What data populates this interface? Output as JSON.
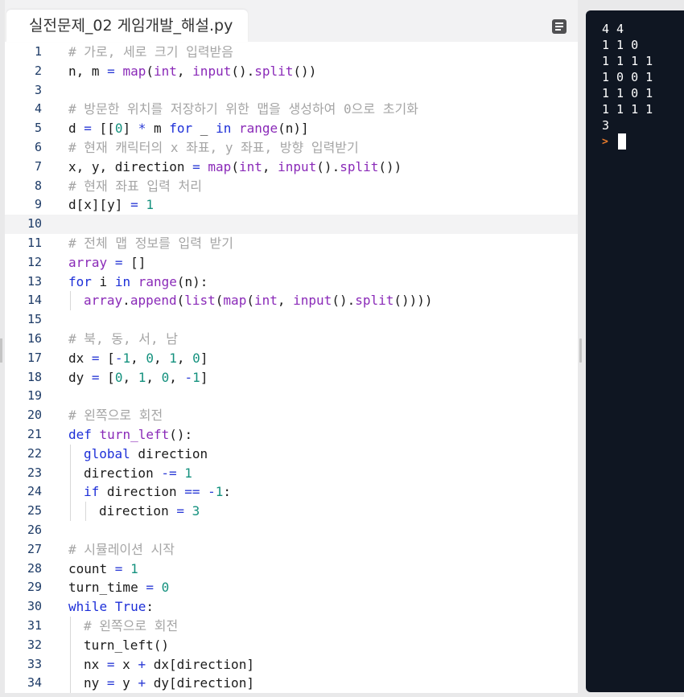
{
  "editor": {
    "tab_title": "실전문제_02 게임개발_해설.py",
    "current_line": 10,
    "lines": [
      {
        "n": "1",
        "indent": 0,
        "tokens": [
          {
            "t": "comment",
            "v": "# 가로, 세로 크기 입력받음"
          }
        ]
      },
      {
        "n": "2",
        "indent": 0,
        "tokens": [
          {
            "t": "plain",
            "v": "n, m "
          },
          {
            "t": "op",
            "v": "="
          },
          {
            "t": "plain",
            "v": " "
          },
          {
            "t": "builtin",
            "v": "map"
          },
          {
            "t": "plain",
            "v": "("
          },
          {
            "t": "builtin",
            "v": "int"
          },
          {
            "t": "plain",
            "v": ", "
          },
          {
            "t": "builtin",
            "v": "input"
          },
          {
            "t": "plain",
            "v": "()."
          },
          {
            "t": "builtin",
            "v": "split"
          },
          {
            "t": "plain",
            "v": "())"
          }
        ]
      },
      {
        "n": "3",
        "indent": 0,
        "tokens": []
      },
      {
        "n": "4",
        "indent": 0,
        "tokens": [
          {
            "t": "comment",
            "v": "# 방문한 위치를 저장하기 위한 맵을 생성하여 0으로 초기화"
          }
        ]
      },
      {
        "n": "5",
        "indent": 0,
        "tokens": [
          {
            "t": "plain",
            "v": "d "
          },
          {
            "t": "op",
            "v": "="
          },
          {
            "t": "plain",
            "v": " [["
          },
          {
            "t": "num",
            "v": "0"
          },
          {
            "t": "plain",
            "v": "] "
          },
          {
            "t": "op",
            "v": "*"
          },
          {
            "t": "plain",
            "v": " m "
          },
          {
            "t": "kw",
            "v": "for"
          },
          {
            "t": "plain",
            "v": " _ "
          },
          {
            "t": "kw",
            "v": "in"
          },
          {
            "t": "plain",
            "v": " "
          },
          {
            "t": "builtin",
            "v": "range"
          },
          {
            "t": "plain",
            "v": "(n)]"
          }
        ]
      },
      {
        "n": "6",
        "indent": 0,
        "tokens": [
          {
            "t": "comment",
            "v": "# 현재 캐릭터의 x 좌표, y 좌표, 방향 입력받기"
          }
        ]
      },
      {
        "n": "7",
        "indent": 0,
        "tokens": [
          {
            "t": "plain",
            "v": "x, y, direction "
          },
          {
            "t": "op",
            "v": "="
          },
          {
            "t": "plain",
            "v": " "
          },
          {
            "t": "builtin",
            "v": "map"
          },
          {
            "t": "plain",
            "v": "("
          },
          {
            "t": "builtin",
            "v": "int"
          },
          {
            "t": "plain",
            "v": ", "
          },
          {
            "t": "builtin",
            "v": "input"
          },
          {
            "t": "plain",
            "v": "()."
          },
          {
            "t": "builtin",
            "v": "split"
          },
          {
            "t": "plain",
            "v": "())"
          }
        ]
      },
      {
        "n": "8",
        "indent": 0,
        "tokens": [
          {
            "t": "comment",
            "v": "# 현재 좌표 입력 처리"
          }
        ]
      },
      {
        "n": "9",
        "indent": 0,
        "tokens": [
          {
            "t": "plain",
            "v": "d[x][y] "
          },
          {
            "t": "op",
            "v": "="
          },
          {
            "t": "plain",
            "v": " "
          },
          {
            "t": "num",
            "v": "1"
          }
        ]
      },
      {
        "n": "10",
        "indent": 0,
        "tokens": []
      },
      {
        "n": "11",
        "indent": 0,
        "tokens": [
          {
            "t": "comment",
            "v": "# 전체 맵 정보를 입력 받기"
          }
        ]
      },
      {
        "n": "12",
        "indent": 0,
        "tokens": [
          {
            "t": "builtin",
            "v": "array"
          },
          {
            "t": "plain",
            "v": " "
          },
          {
            "t": "op",
            "v": "="
          },
          {
            "t": "plain",
            "v": " []"
          }
        ]
      },
      {
        "n": "13",
        "indent": 0,
        "tokens": [
          {
            "t": "kw",
            "v": "for"
          },
          {
            "t": "plain",
            "v": " i "
          },
          {
            "t": "kw",
            "v": "in"
          },
          {
            "t": "plain",
            "v": " "
          },
          {
            "t": "builtin",
            "v": "range"
          },
          {
            "t": "plain",
            "v": "(n):"
          }
        ]
      },
      {
        "n": "14",
        "indent": 1,
        "tokens": [
          {
            "t": "builtin",
            "v": "array"
          },
          {
            "t": "plain",
            "v": "."
          },
          {
            "t": "builtin",
            "v": "append"
          },
          {
            "t": "plain",
            "v": "("
          },
          {
            "t": "builtin",
            "v": "list"
          },
          {
            "t": "plain",
            "v": "("
          },
          {
            "t": "builtin",
            "v": "map"
          },
          {
            "t": "plain",
            "v": "("
          },
          {
            "t": "builtin",
            "v": "int"
          },
          {
            "t": "plain",
            "v": ", "
          },
          {
            "t": "builtin",
            "v": "input"
          },
          {
            "t": "plain",
            "v": "()."
          },
          {
            "t": "builtin",
            "v": "split"
          },
          {
            "t": "plain",
            "v": "())))"
          }
        ]
      },
      {
        "n": "15",
        "indent": 0,
        "tokens": []
      },
      {
        "n": "16",
        "indent": 0,
        "tokens": [
          {
            "t": "comment",
            "v": "# 북, 동, 서, 남"
          }
        ]
      },
      {
        "n": "17",
        "indent": 0,
        "tokens": [
          {
            "t": "plain",
            "v": "dx "
          },
          {
            "t": "op",
            "v": "="
          },
          {
            "t": "plain",
            "v": " ["
          },
          {
            "t": "op",
            "v": "-"
          },
          {
            "t": "num",
            "v": "1"
          },
          {
            "t": "plain",
            "v": ", "
          },
          {
            "t": "num",
            "v": "0"
          },
          {
            "t": "plain",
            "v": ", "
          },
          {
            "t": "num",
            "v": "1"
          },
          {
            "t": "plain",
            "v": ", "
          },
          {
            "t": "num",
            "v": "0"
          },
          {
            "t": "plain",
            "v": "]"
          }
        ]
      },
      {
        "n": "18",
        "indent": 0,
        "tokens": [
          {
            "t": "plain",
            "v": "dy "
          },
          {
            "t": "op",
            "v": "="
          },
          {
            "t": "plain",
            "v": " ["
          },
          {
            "t": "num",
            "v": "0"
          },
          {
            "t": "plain",
            "v": ", "
          },
          {
            "t": "num",
            "v": "1"
          },
          {
            "t": "plain",
            "v": ", "
          },
          {
            "t": "num",
            "v": "0"
          },
          {
            "t": "plain",
            "v": ", "
          },
          {
            "t": "op",
            "v": "-"
          },
          {
            "t": "num",
            "v": "1"
          },
          {
            "t": "plain",
            "v": "]"
          }
        ]
      },
      {
        "n": "19",
        "indent": 0,
        "tokens": []
      },
      {
        "n": "20",
        "indent": 0,
        "tokens": [
          {
            "t": "comment",
            "v": "# 왼쪽으로 회전"
          }
        ]
      },
      {
        "n": "21",
        "indent": 0,
        "tokens": [
          {
            "t": "kw",
            "v": "def"
          },
          {
            "t": "plain",
            "v": " "
          },
          {
            "t": "builtin",
            "v": "turn_left"
          },
          {
            "t": "plain",
            "v": "():"
          }
        ]
      },
      {
        "n": "22",
        "indent": 1,
        "tokens": [
          {
            "t": "kw",
            "v": "global"
          },
          {
            "t": "plain",
            "v": " direction"
          }
        ]
      },
      {
        "n": "23",
        "indent": 1,
        "tokens": [
          {
            "t": "plain",
            "v": "direction "
          },
          {
            "t": "op",
            "v": "-="
          },
          {
            "t": "plain",
            "v": " "
          },
          {
            "t": "num",
            "v": "1"
          }
        ]
      },
      {
        "n": "24",
        "indent": 1,
        "tokens": [
          {
            "t": "kw",
            "v": "if"
          },
          {
            "t": "plain",
            "v": " direction "
          },
          {
            "t": "op",
            "v": "=="
          },
          {
            "t": "plain",
            "v": " "
          },
          {
            "t": "op",
            "v": "-"
          },
          {
            "t": "num",
            "v": "1"
          },
          {
            "t": "plain",
            "v": ":"
          }
        ]
      },
      {
        "n": "25",
        "indent": 2,
        "tokens": [
          {
            "t": "plain",
            "v": "direction "
          },
          {
            "t": "op",
            "v": "="
          },
          {
            "t": "plain",
            "v": " "
          },
          {
            "t": "num",
            "v": "3"
          }
        ]
      },
      {
        "n": "26",
        "indent": 0,
        "tokens": []
      },
      {
        "n": "27",
        "indent": 0,
        "tokens": [
          {
            "t": "comment",
            "v": "# 시뮬레이션 시작"
          }
        ]
      },
      {
        "n": "28",
        "indent": 0,
        "tokens": [
          {
            "t": "plain",
            "v": "count "
          },
          {
            "t": "op",
            "v": "="
          },
          {
            "t": "plain",
            "v": " "
          },
          {
            "t": "num",
            "v": "1"
          }
        ]
      },
      {
        "n": "29",
        "indent": 0,
        "tokens": [
          {
            "t": "plain",
            "v": "turn_time "
          },
          {
            "t": "op",
            "v": "="
          },
          {
            "t": "plain",
            "v": " "
          },
          {
            "t": "num",
            "v": "0"
          }
        ]
      },
      {
        "n": "30",
        "indent": 0,
        "tokens": [
          {
            "t": "kw",
            "v": "while"
          },
          {
            "t": "plain",
            "v": " "
          },
          {
            "t": "kw",
            "v": "True"
          },
          {
            "t": "plain",
            "v": ":"
          }
        ]
      },
      {
        "n": "31",
        "indent": 1,
        "tokens": [
          {
            "t": "comment",
            "v": "# 왼쪽으로 회전"
          }
        ]
      },
      {
        "n": "32",
        "indent": 1,
        "tokens": [
          {
            "t": "plain",
            "v": "turn_left()"
          }
        ]
      },
      {
        "n": "33",
        "indent": 1,
        "tokens": [
          {
            "t": "plain",
            "v": "nx "
          },
          {
            "t": "op",
            "v": "="
          },
          {
            "t": "plain",
            "v": " x "
          },
          {
            "t": "op",
            "v": "+"
          },
          {
            "t": "plain",
            "v": " dx[direction]"
          }
        ]
      },
      {
        "n": "34",
        "indent": 1,
        "tokens": [
          {
            "t": "plain",
            "v": "ny "
          },
          {
            "t": "op",
            "v": "="
          },
          {
            "t": "plain",
            "v": " y "
          },
          {
            "t": "op",
            "v": "+"
          },
          {
            "t": "plain",
            "v": " dy[direction]"
          }
        ]
      }
    ]
  },
  "terminal": {
    "lines": [
      "4 4",
      "1 1 0",
      "1 1 1 1",
      "1 0 0 1",
      "1 1 0 1",
      "1 1 1 1",
      "3"
    ],
    "prompt": ">"
  },
  "colors": {
    "comment": "#a5a5a5",
    "keyword": "#1d2fd8",
    "builtin": "#8a2ab8",
    "number": "#14917e",
    "terminal_bg": "#0f1622",
    "prompt": "#e87b2c"
  }
}
